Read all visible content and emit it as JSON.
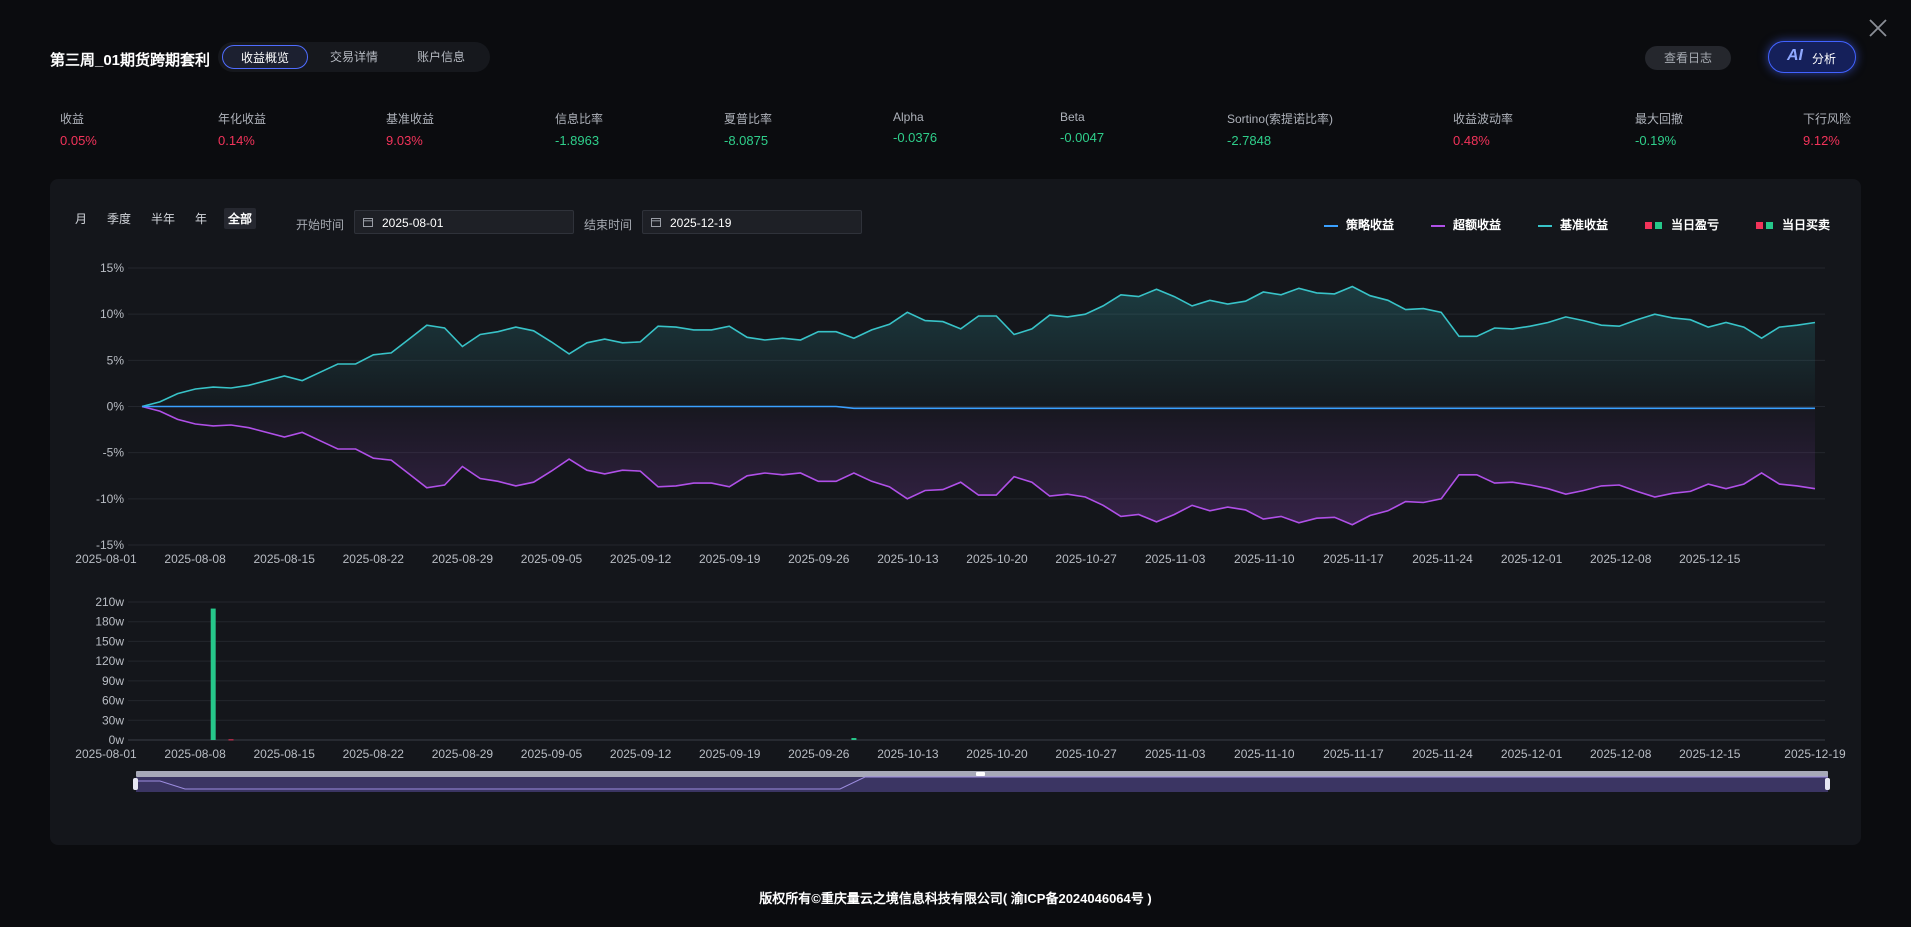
{
  "header": {
    "title": "第三周_01期货跨期套利",
    "tabs": [
      "收益概览",
      "交易详情",
      "账户信息"
    ],
    "log_button": "查看日志",
    "ai_button": {
      "badge": "AI",
      "label": "分析"
    }
  },
  "metrics": [
    {
      "label": "收益",
      "value": "0.05%",
      "tone": "red"
    },
    {
      "label": "年化收益",
      "value": "0.14%",
      "tone": "red"
    },
    {
      "label": "基准收益",
      "value": "9.03%",
      "tone": "red"
    },
    {
      "label": "信息比率",
      "value": "-1.8963",
      "tone": "green"
    },
    {
      "label": "夏普比率",
      "value": "-8.0875",
      "tone": "green"
    },
    {
      "label": "Alpha",
      "value": "-0.0376",
      "tone": "green"
    },
    {
      "label": "Beta",
      "value": "-0.0047",
      "tone": "green"
    },
    {
      "label": "Sortino(索提诺比率)",
      "value": "-2.7848",
      "tone": "green"
    },
    {
      "label": "收益波动率",
      "value": "0.48%",
      "tone": "red"
    },
    {
      "label": "最大回撤",
      "value": "-0.19%",
      "tone": "green"
    },
    {
      "label": "下行风险",
      "value": "9.12%",
      "tone": "red"
    }
  ],
  "filters": {
    "periods": [
      "月",
      "季度",
      "半年",
      "年",
      "全部"
    ],
    "active_period": "全部",
    "start_label": "开始时间",
    "start_date": "2025-08-01",
    "end_label": "结束时间",
    "end_date": "2025-12-19"
  },
  "legend": {
    "strategy": "策略收益",
    "excess": "超额收益",
    "benchmark": "基准收益",
    "daily_pnl": "当日盈亏",
    "daily_trade": "当日买卖"
  },
  "colors": {
    "strategy": "#3aa0ff",
    "excess": "#b050e8",
    "benchmark": "#38c3c8",
    "positive": "#f2335a",
    "negative": "#26c78a",
    "accent": "#4f6cff"
  },
  "chart_data": [
    {
      "type": "line",
      "x_labels": [
        "2025-08-01",
        "2025-08-08",
        "2025-08-15",
        "2025-08-22",
        "2025-08-29",
        "2025-09-05",
        "2025-09-12",
        "2025-09-19",
        "2025-09-26",
        "2025-10-13",
        "2025-10-20",
        "2025-10-27",
        "2025-11-03",
        "2025-11-10",
        "2025-11-17",
        "2025-11-24",
        "2025-12-01",
        "2025-12-08",
        "2025-12-15"
      ],
      "y_ticks": [
        "15%",
        "10%",
        "5%",
        "0%",
        "-5%",
        "-10%",
        "-15%"
      ],
      "ylim": [
        -15,
        15
      ],
      "grid": true,
      "legend_position": "top-right",
      "series": [
        {
          "name": "基准收益",
          "values": [
            0,
            0.5,
            1.4,
            1.9,
            2.1,
            2.0,
            2.3,
            2.8,
            3.3,
            2.8,
            3.7,
            4.6,
            4.6,
            5.6,
            5.8,
            7.3,
            8.8,
            8.5,
            6.5,
            7.8,
            8.1,
            8.6,
            8.2,
            7.0,
            5.7,
            6.9,
            7.3,
            6.9,
            7.0,
            8.7,
            8.6,
            8.3,
            8.3,
            8.7,
            7.5,
            7.2,
            7.4,
            7.2,
            8.1,
            8.1,
            7.4,
            8.3,
            8.9,
            10.2,
            9.3,
            9.2,
            8.4,
            9.8,
            9.8,
            7.8,
            8.4,
            9.9,
            9.7,
            10.0,
            10.9,
            12.1,
            11.9,
            12.7,
            11.9,
            10.9,
            11.5,
            11.1,
            11.4,
            12.4,
            12.1,
            12.8,
            12.3,
            12.2,
            13.0,
            12.0,
            11.5,
            10.5,
            10.6,
            10.2,
            7.6,
            7.6,
            8.5,
            8.4,
            8.7,
            9.1,
            9.7,
            9.3,
            8.8,
            8.7,
            9.4,
            10.0,
            9.6,
            9.4,
            8.6,
            9.1,
            8.6,
            7.4,
            8.6,
            8.8,
            9.1
          ]
        },
        {
          "name": "超额收益",
          "values": [
            0,
            -0.5,
            -1.4,
            -1.9,
            -2.1,
            -2.0,
            -2.3,
            -2.8,
            -3.3,
            -2.8,
            -3.7,
            -4.6,
            -4.6,
            -5.6,
            -5.8,
            -7.3,
            -8.8,
            -8.5,
            -6.5,
            -7.8,
            -8.1,
            -8.6,
            -8.2,
            -7.0,
            -5.7,
            -6.9,
            -7.3,
            -6.9,
            -7.0,
            -8.7,
            -8.6,
            -8.3,
            -8.3,
            -8.7,
            -7.5,
            -7.2,
            -7.4,
            -7.2,
            -8.1,
            -8.1,
            -7.2,
            -8.1,
            -8.7,
            -10.0,
            -9.1,
            -9.0,
            -8.2,
            -9.6,
            -9.6,
            -7.6,
            -8.2,
            -9.7,
            -9.5,
            -9.8,
            -10.7,
            -11.9,
            -11.7,
            -12.5,
            -11.7,
            -10.7,
            -11.3,
            -10.9,
            -11.2,
            -12.2,
            -11.9,
            -12.6,
            -12.1,
            -12.0,
            -12.8,
            -11.8,
            -11.3,
            -10.3,
            -10.4,
            -10.0,
            -7.4,
            -7.4,
            -8.3,
            -8.2,
            -8.5,
            -8.9,
            -9.5,
            -9.1,
            -8.6,
            -8.5,
            -9.2,
            -9.8,
            -9.4,
            -9.2,
            -8.4,
            -8.9,
            -8.4,
            -7.2,
            -8.4,
            -8.6,
            -8.9
          ]
        },
        {
          "name": "策略收益",
          "values": [
            0,
            0,
            0,
            0,
            0,
            0,
            0,
            0,
            0,
            0,
            0,
            0,
            0,
            0,
            0,
            0,
            0,
            0,
            0,
            0,
            0,
            0,
            0,
            0,
            0,
            0,
            0,
            0,
            0,
            0,
            0,
            0,
            0,
            0,
            0,
            0,
            0,
            0,
            0,
            0,
            -0.2,
            -0.2,
            -0.2,
            -0.2,
            -0.2,
            -0.2,
            -0.2,
            -0.2,
            -0.2,
            -0.2,
            -0.2,
            -0.2,
            -0.2,
            -0.2,
            -0.2,
            -0.2,
            -0.2,
            -0.2,
            -0.2,
            -0.2,
            -0.2,
            -0.2,
            -0.2,
            -0.2,
            -0.2,
            -0.2,
            -0.2,
            -0.2,
            -0.2,
            -0.2,
            -0.2,
            -0.2,
            -0.2,
            -0.2,
            -0.2,
            -0.2,
            -0.2,
            -0.2,
            -0.2,
            -0.2,
            -0.2,
            -0.2,
            -0.2,
            -0.2,
            -0.2,
            -0.2,
            -0.2,
            -0.2,
            -0.2,
            -0.2,
            -0.2,
            -0.2,
            -0.2,
            -0.2,
            -0.2
          ]
        }
      ]
    },
    {
      "type": "bar",
      "x_labels": [
        "2025-08-01",
        "2025-08-08",
        "2025-08-15",
        "2025-08-22",
        "2025-08-29",
        "2025-09-05",
        "2025-09-12",
        "2025-09-19",
        "2025-09-26",
        "2025-10-13",
        "2025-10-20",
        "2025-10-27",
        "2025-11-03",
        "2025-11-10",
        "2025-11-17",
        "2025-11-24",
        "2025-12-01",
        "2025-12-08",
        "2025-12-15",
        "2025-12-19"
      ],
      "y_ticks": [
        "210w",
        "180w",
        "150w",
        "120w",
        "90w",
        "60w",
        "30w",
        "0w"
      ],
      "ylim": [
        0,
        210
      ],
      "grid": true,
      "series": [
        {
          "name": "当日盈亏",
          "bars": [
            {
              "index": 4,
              "value": 200,
              "sign": "negative"
            },
            {
              "index": 5,
              "value": 1,
              "sign": "positive"
            },
            {
              "index": 40,
              "value": 3,
              "sign": "negative"
            }
          ]
        }
      ]
    }
  ],
  "footer": "版权所有©重庆量云之境信息科技有限公司( 渝ICP备2024046064号 )"
}
